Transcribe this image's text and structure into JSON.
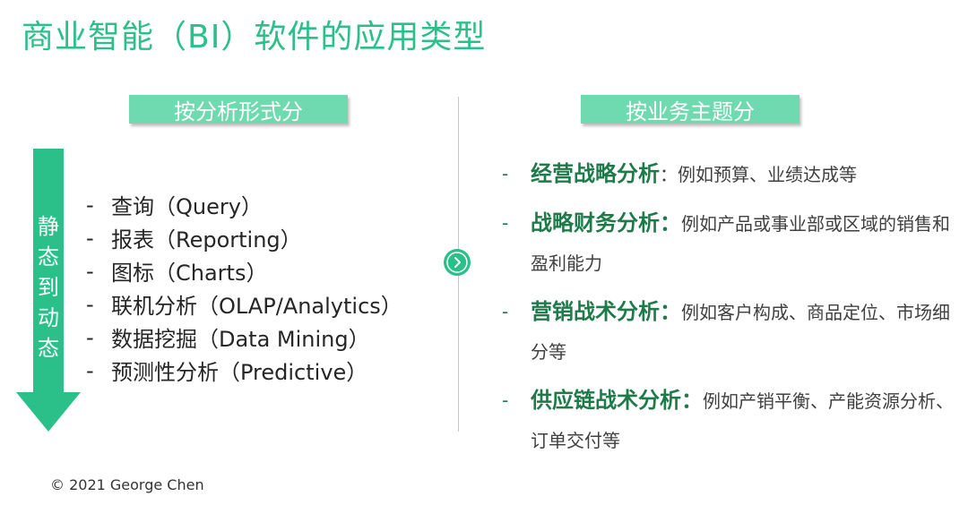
{
  "title": "商业智能（BI）软件的应用类型",
  "left_header": "按分析形式分",
  "right_header": "按业务主题分",
  "arrow": {
    "chars": [
      "静",
      "态",
      "到",
      "动",
      "态"
    ],
    "color": "#2bbf8a"
  },
  "dash": "-",
  "methods": [
    "查询（Query）",
    "报表（Reporting）",
    "图标（Charts）",
    "联机分析（OLAP/Analytics）",
    "数据挖掘（Data Mining）",
    "预测性分析（Predictive）"
  ],
  "topics": [
    {
      "name": "经营战略分析",
      "desc": "：例如预算、业绩达成等"
    },
    {
      "name": "战略财务分析：",
      "desc": "例如产品或事业部或区域的销售和盈利能力"
    },
    {
      "name": "营销战术分析：",
      "desc": "例如客户构成、商品定位、市场细分等"
    },
    {
      "name": "供应链战术分析：",
      "desc": "例如产销平衡、产能资源分析、订单交付等"
    }
  ],
  "footer": "© 2021 George Chen",
  "colors": {
    "accent": "#2bbf8a",
    "header_bg": "#6fd9b0",
    "topic_name": "#1f7a4a"
  }
}
